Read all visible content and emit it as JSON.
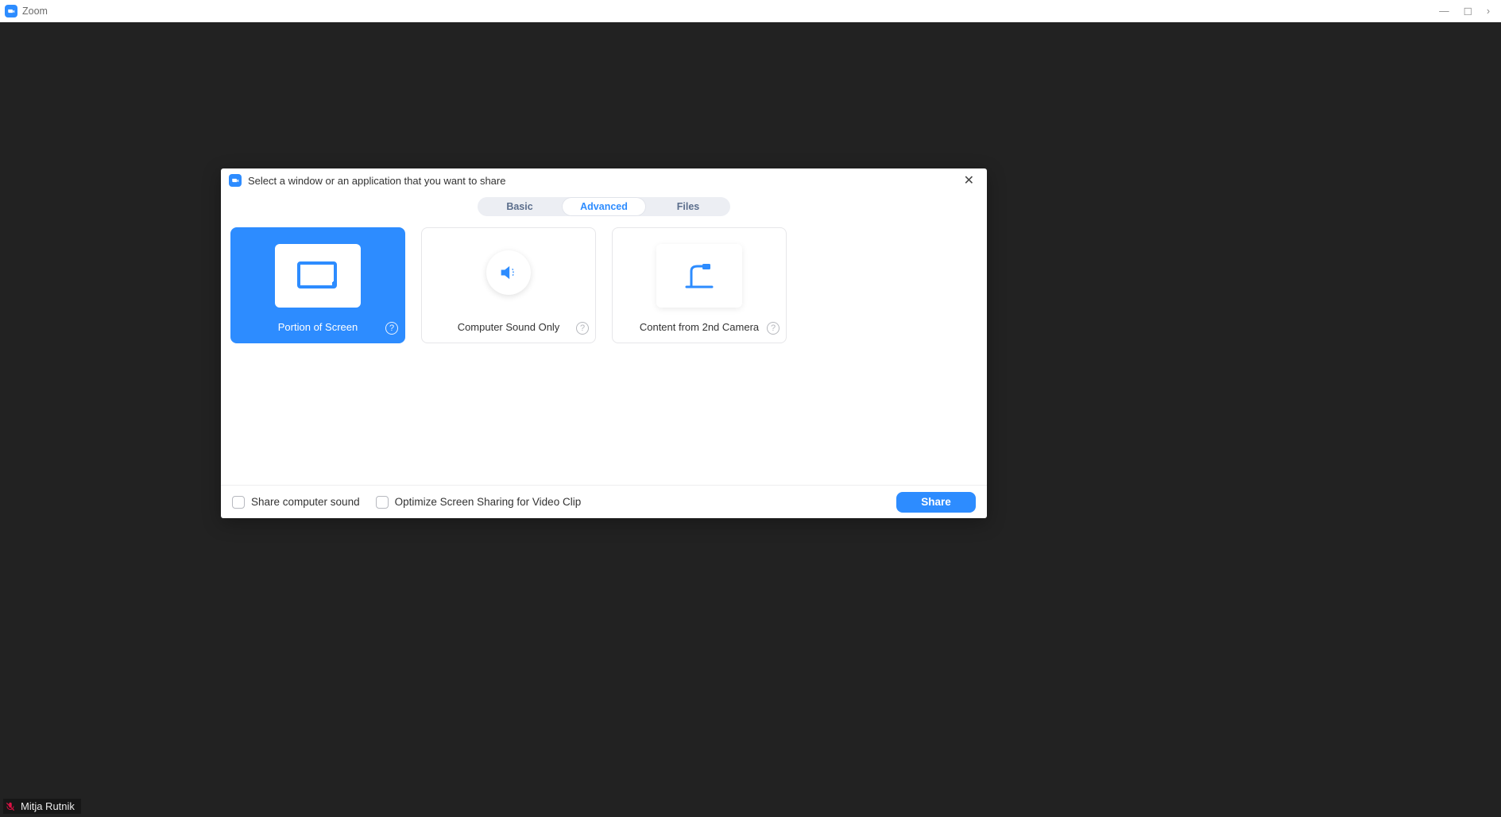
{
  "app": {
    "title": "Zoom"
  },
  "dialog": {
    "title": "Select a window or an application that you want to share",
    "tabs": {
      "basic": "Basic",
      "advanced": "Advanced",
      "files": "Files",
      "active": "advanced"
    },
    "options": {
      "portion": "Portion of Screen",
      "sound": "Computer Sound Only",
      "camera": "Content from 2nd Camera"
    },
    "footer": {
      "share_sound": "Share computer sound",
      "optimize_video": "Optimize Screen Sharing for Video Clip",
      "share_button": "Share"
    }
  },
  "participant": {
    "name": "Mitja Rutnik",
    "muted": true
  }
}
